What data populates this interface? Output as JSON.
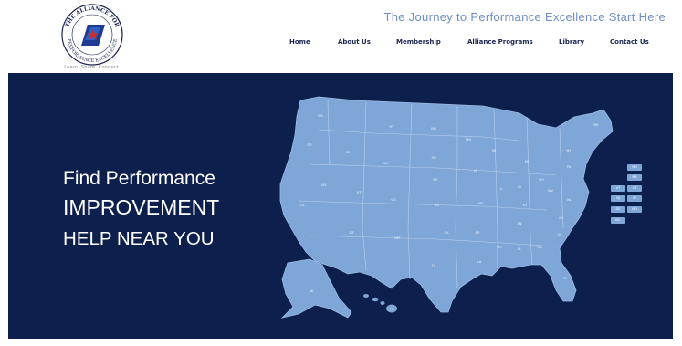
{
  "logo": {
    "top_text": "THE ALLIANCE FOR",
    "bottom_text": "PERFORMANCE EXCELLENCE",
    "tagline": "Learn. Share. Connect."
  },
  "header": {
    "headline": "The Journey to Performance Excellence Start Here"
  },
  "nav": {
    "items": [
      {
        "label": "Home"
      },
      {
        "label": "About Us"
      },
      {
        "label": "Membership"
      },
      {
        "label": "Alliance Programs"
      },
      {
        "label": "Library"
      },
      {
        "label": "Contact Us"
      }
    ]
  },
  "hero": {
    "line1": "Find Performance",
    "line2": "IMPROVEMENT",
    "line3": "HELP NEAR YOU"
  },
  "colors": {
    "hero_bg": "#0d1f4c",
    "map_fill": "#7ea7d8",
    "accent": "#6e8ec6",
    "nav_text": "#1b2550"
  },
  "map": {
    "state_labels": [
      "WA",
      "OR",
      "ID",
      "MT",
      "ND",
      "MN",
      "WI",
      "MI",
      "NY",
      "ME",
      "CA",
      "NV",
      "UT",
      "WY",
      "SD",
      "IA",
      "IL",
      "IN",
      "OH",
      "PA",
      "AZ",
      "CO",
      "NE",
      "MO",
      "KY",
      "WV",
      "VA",
      "NM",
      "KS",
      "AR",
      "TN",
      "NC",
      "TX",
      "OK",
      "LA",
      "MS",
      "AL",
      "GA",
      "SC",
      "FL",
      "AK",
      "HI"
    ],
    "northeast_buttons": [
      "NH",
      "MA",
      "VT",
      "CT",
      "NJ",
      "RI",
      "DE",
      "MD",
      "DC"
    ]
  }
}
